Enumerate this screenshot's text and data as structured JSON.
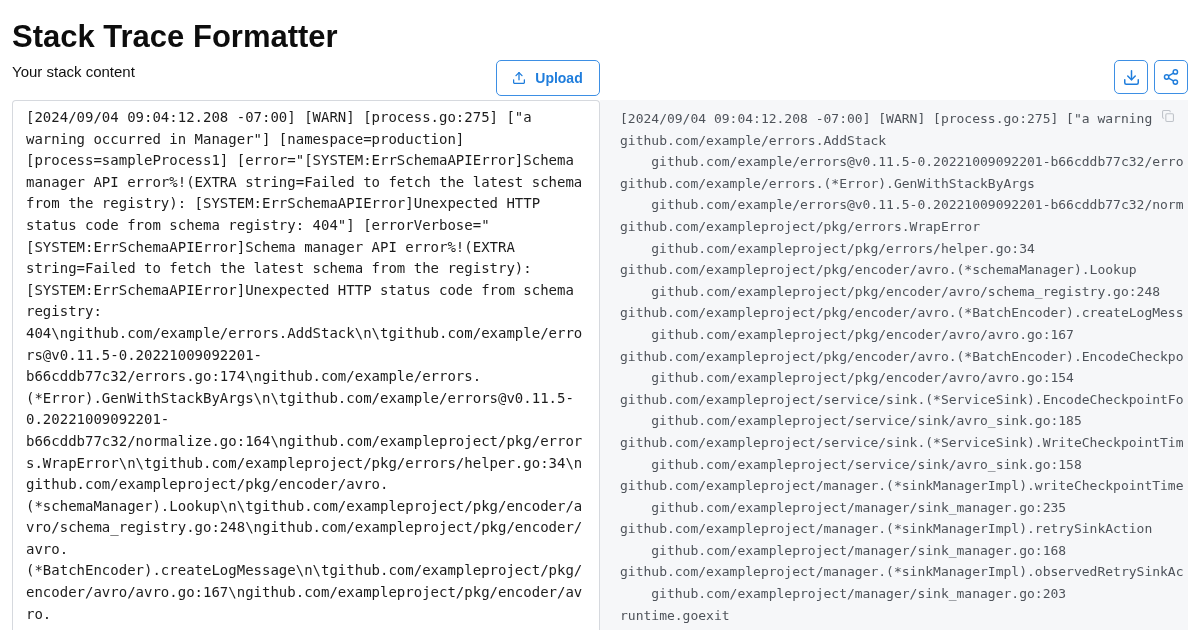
{
  "title": "Stack Trace Formatter",
  "input": {
    "label": "Your stack content",
    "upload_button": "Upload",
    "value": "[2024/09/04 09:04:12.208 -07:00] [WARN] [process.go:275] [\"a warning occurred in Manager\"] [namespace=production] [process=sampleProcess1] [error=\"[SYSTEM:ErrSchemaAPIError]Schema manager API error%!(EXTRA string=Failed to fetch the latest schema from the registry): [SYSTEM:ErrSchemaAPIError]Unexpected HTTP status code from schema registry: 404\"] [errorVerbose=\"[SYSTEM:ErrSchemaAPIError]Schema manager API error%!(EXTRA string=Failed to fetch the latest schema from the registry): [SYSTEM:ErrSchemaAPIError]Unexpected HTTP status code from schema registry: 404\\ngithub.com/example/errors.AddStack\\n\\tgithub.com/example/errors@v0.11.5-0.20221009092201-b66cddb77c32/errors.go:174\\ngithub.com/example/errors.(*Error).GenWithStackByArgs\\n\\tgithub.com/example/errors@v0.11.5-0.20221009092201-b66cddb77c32/normalize.go:164\\ngithub.com/exampleproject/pkg/errors.WrapError\\n\\tgithub.com/exampleproject/pkg/errors/helper.go:34\\ngithub.com/exampleproject/pkg/encoder/avro.(*schemaManager).Lookup\\n\\tgithub.com/exampleproject/pkg/encoder/avro/schema_registry.go:248\\ngithub.com/exampleproject/pkg/encoder/avro.(*BatchEncoder).createLogMessage\\n\\tgithub.com/exampleproject/pkg/encoder/avro/avro.go:167\\ngithub.com/exampleproject/pkg/encoder/avro."
  },
  "output": {
    "message": "[2024/09/04 09:04:12.208 -07:00] [WARN] [process.go:275] [\"a warning",
    "frames": [
      {
        "function": "github.com/example/errors.AddStack",
        "location": "github.com/example/errors@v0.11.5-0.20221009092201-b66cddb77c32/erro"
      },
      {
        "function": "github.com/example/errors.(*Error).GenWithStackByArgs",
        "location": "github.com/example/errors@v0.11.5-0.20221009092201-b66cddb77c32/norm"
      },
      {
        "function": "github.com/exampleproject/pkg/errors.WrapError",
        "location": "github.com/exampleproject/pkg/errors/helper.go:34"
      },
      {
        "function": "github.com/exampleproject/pkg/encoder/avro.(*schemaManager).Lookup",
        "location": "github.com/exampleproject/pkg/encoder/avro/schema_registry.go:248"
      },
      {
        "function": "github.com/exampleproject/pkg/encoder/avro.(*BatchEncoder).createLogMess",
        "location": "github.com/exampleproject/pkg/encoder/avro/avro.go:167"
      },
      {
        "function": "github.com/exampleproject/pkg/encoder/avro.(*BatchEncoder).EncodeCheckpo",
        "location": "github.com/exampleproject/pkg/encoder/avro/avro.go:154"
      },
      {
        "function": "github.com/exampleproject/service/sink.(*ServiceSink).EncodeCheckpointFo",
        "location": "github.com/exampleproject/service/sink/avro_sink.go:185"
      },
      {
        "function": "github.com/exampleproject/service/sink.(*ServiceSink).WriteCheckpointTim",
        "location": "github.com/exampleproject/service/sink/avro_sink.go:158"
      },
      {
        "function": "github.com/exampleproject/manager.(*sinkManagerImpl).writeCheckpointTime",
        "location": "github.com/exampleproject/manager/sink_manager.go:235"
      },
      {
        "function": "github.com/exampleproject/manager.(*sinkManagerImpl).retrySinkAction",
        "location": "github.com/exampleproject/manager/sink_manager.go:168"
      },
      {
        "function": "github.com/exampleproject/manager.(*sinkManagerImpl).observedRetrySinkAc",
        "location": "github.com/exampleproject/manager/sink_manager.go:203"
      },
      {
        "function": "runtime.goexit"
      }
    ]
  }
}
